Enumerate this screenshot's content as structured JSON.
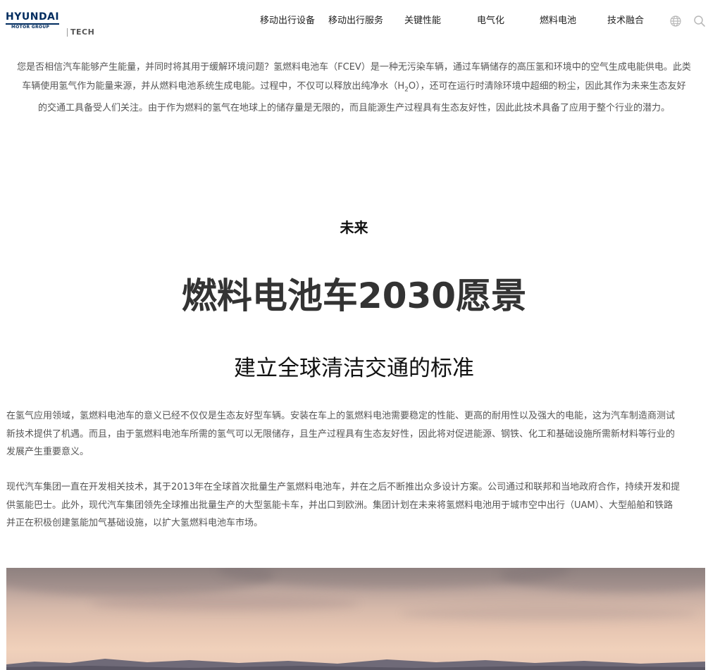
{
  "header": {
    "logo": {
      "brand": "HYUNDAI",
      "sub": "MOTOR GROUP",
      "tech": "TECH"
    },
    "nav": [
      {
        "label": "移动出行设备"
      },
      {
        "label": "移动出行服务"
      },
      {
        "label": "关键性能"
      },
      {
        "label": "电气化"
      },
      {
        "label": "燃料电池"
      },
      {
        "label": "技术融合"
      }
    ],
    "icons": [
      "globe-icon",
      "search-icon"
    ]
  },
  "intro": {
    "line1": "您是否相信汽车能够产生能量，并同时将其用于缓解环境问题？氢燃料电池车（FCEV）是一种无污染车辆，通过车辆储存的高压氢和环境中的空气生成电能供电。此类",
    "line2_a": "车辆使用氢气作为能量来源，并从燃料电池系统生成电能。过程中，不仅可以释放出纯净水（H",
    "line2_sub": "2",
    "line2_b": "O），还可在运行时清除环境中超细的粉尘，因此其作为未来生态友好",
    "line3": "的交通工具备受人们关注。由于作为燃料的氢气在地球上的储存量是无限的，而且能源生产过程具有生态友好性，因此此技术具备了应用于整个行业的潜力。"
  },
  "section": {
    "label": "未来",
    "title": "燃料电池车2030愿景",
    "subtitle": "建立全球清洁交通的标准"
  },
  "paragraphs": [
    {
      "lines": [
        "在氢气应用领域，氢燃料电池车的意义已经不仅仅是生态友好型车辆。安装在车上的氢燃料电池需要稳定的性能、更高的耐用性以及强大的电能，这为汽车制造商测试",
        "新技术提供了机遇。而且，由于氢燃料电池车所需的氢气可以无限储存，且生产过程具有生态友好性，因此将对促进能源、钢铁、化工和基础设施所需新材料等行业的",
        "发展产生重要意义。"
      ]
    },
    {
      "lines": [
        "现代汽车集团一直在开发相关技术，其于2013年在全球首次批量生产氢燃料电池车，并在之后不断推出众多设计方案。公司通过和联邦和当地政府合作，持续开发和提",
        "供氢能巴士。此外，现代汽车集团领先全球推出批量生产的大型氢能卡车，并出口到欧洲。集团计划在未来将氢燃料电池用于城市空中出行（UAM）、大型船舶和铁路",
        "并正在积极创建氢能加气基础设施，以扩大氢燃料电池车市场。"
      ]
    }
  ],
  "colors": {
    "brand": "#002c5f",
    "text": "#555555",
    "heading": "#333333"
  }
}
